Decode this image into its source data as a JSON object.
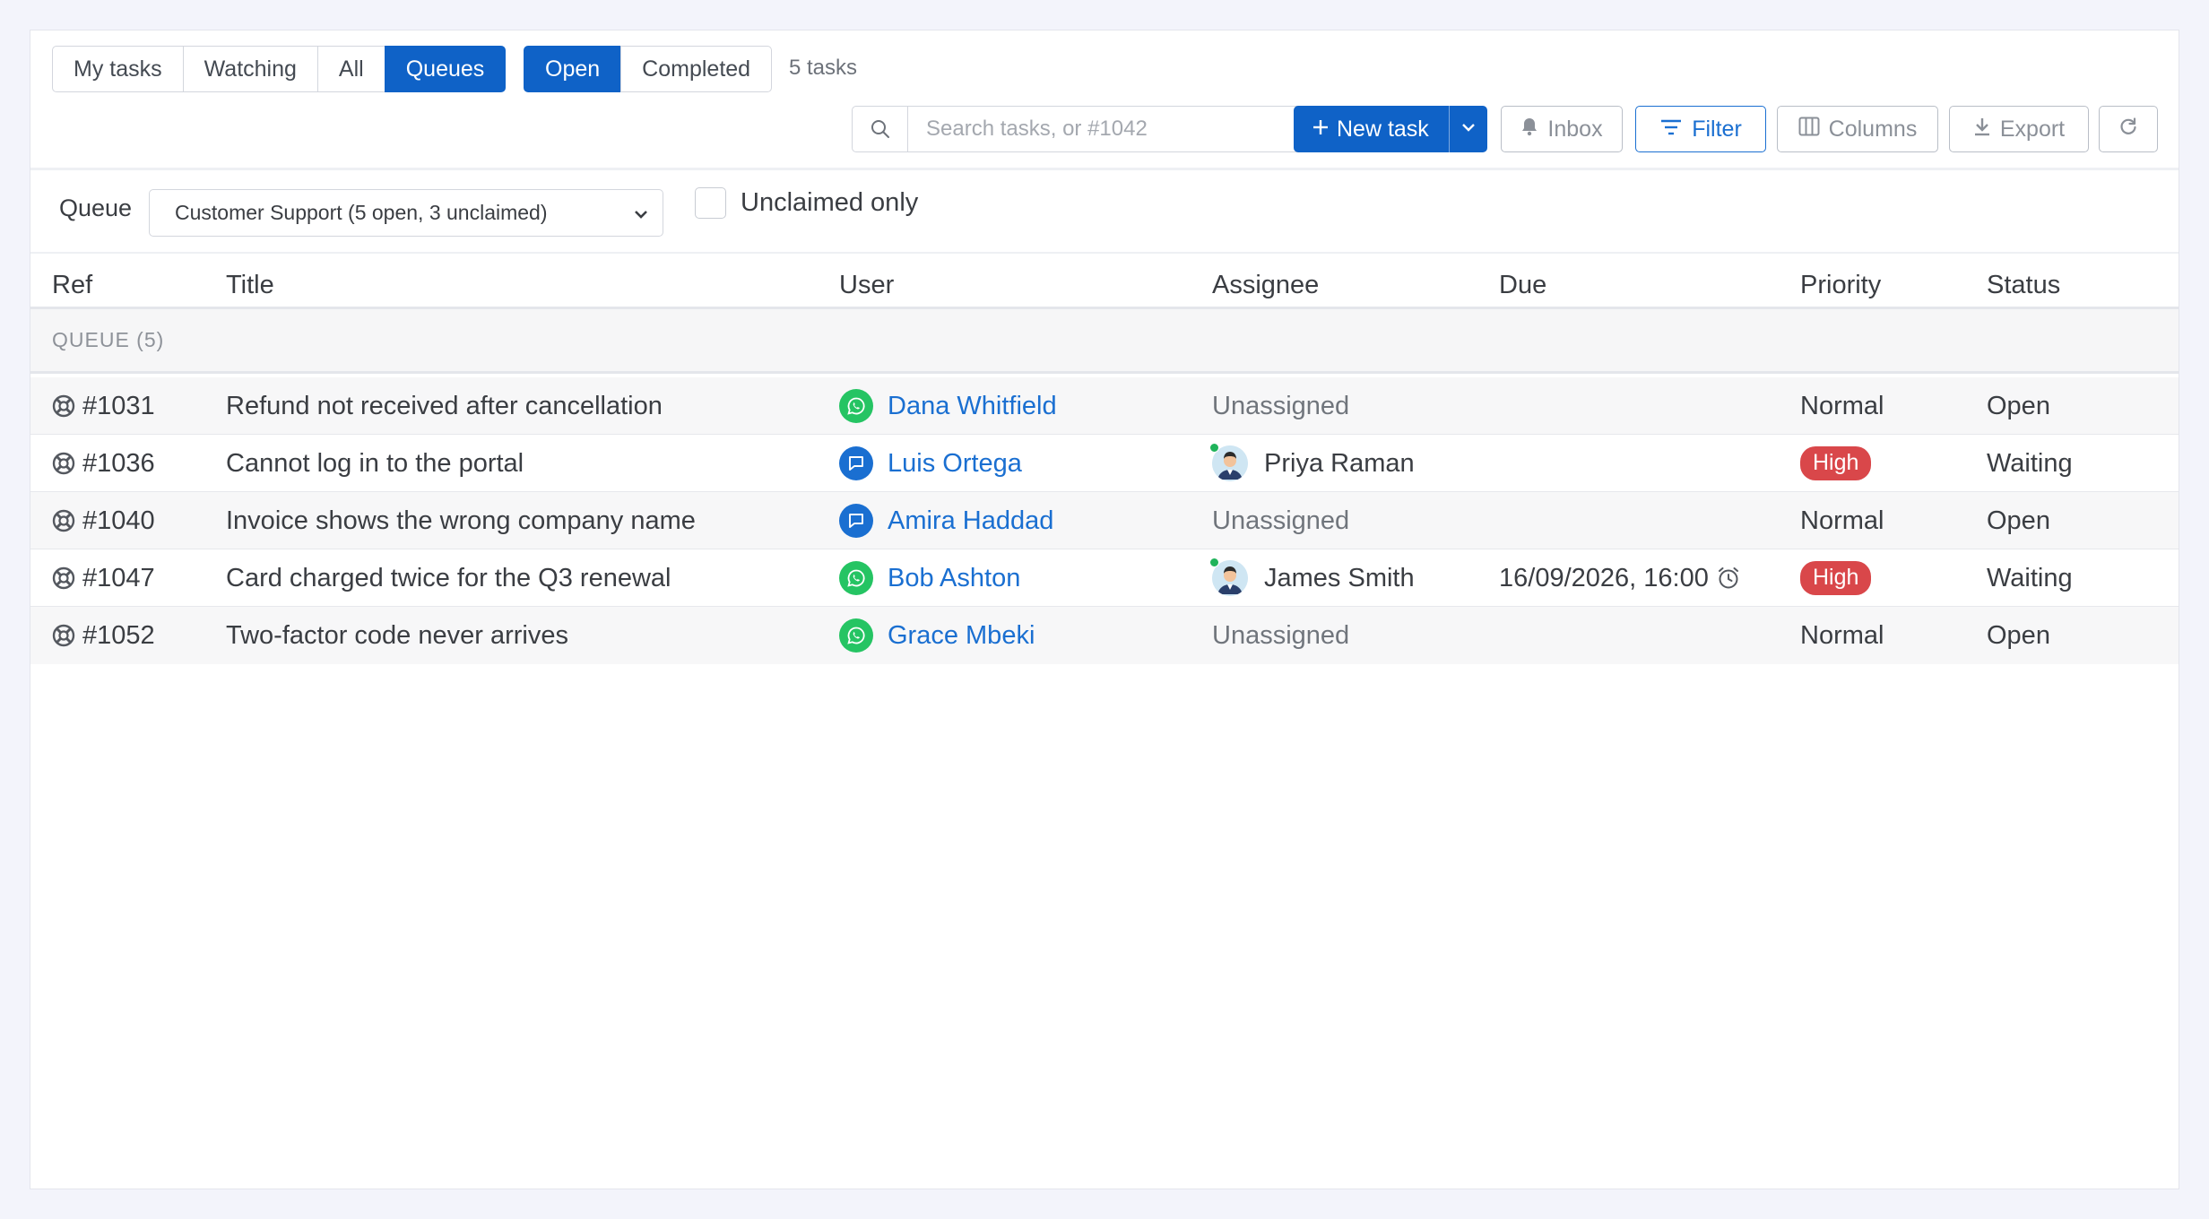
{
  "toolbar": {
    "scope_tabs": [
      {
        "label": "My tasks",
        "active": false
      },
      {
        "label": "Watching",
        "active": false
      },
      {
        "label": "All",
        "active": false
      },
      {
        "label": "Queues",
        "active": true
      }
    ],
    "state_tabs": [
      {
        "label": "Open",
        "active": true
      },
      {
        "label": "Completed",
        "active": false
      }
    ],
    "task_count": "5 tasks",
    "search_placeholder": "Search tasks, or #1042",
    "new_task_label": "New task",
    "inbox_label": "Inbox",
    "filter_label": "Filter",
    "columns_label": "Columns",
    "export_label": "Export"
  },
  "queue_filter": {
    "label": "Queue",
    "selected": "Customer Support (5 open, 3 unclaimed)",
    "unclaimed_only_label": "Unclaimed only",
    "unclaimed_only_checked": false
  },
  "table": {
    "columns": [
      "Ref",
      "Title",
      "User",
      "Assignee",
      "Due",
      "Priority",
      "Status"
    ],
    "group_label": "QUEUE (5)",
    "rows": [
      {
        "ref": "#1031",
        "title": "Refund not received after cancellation",
        "channel": "whatsapp-icon",
        "user": "Dana Whitfield",
        "assignee": "Unassigned",
        "assigned": false,
        "due": "",
        "priority": "Normal",
        "status": "Open"
      },
      {
        "ref": "#1036",
        "title": "Cannot log in to the portal",
        "channel": "chat-icon",
        "user": "Luis Ortega",
        "assignee": "Priya Raman",
        "assigned": true,
        "due": "",
        "priority": "High",
        "status": "Waiting"
      },
      {
        "ref": "#1040",
        "title": "Invoice shows the wrong company name",
        "channel": "chat-icon",
        "user": "Amira Haddad",
        "assignee": "Unassigned",
        "assigned": false,
        "due": "",
        "priority": "Normal",
        "status": "Open"
      },
      {
        "ref": "#1047",
        "title": "Card charged twice for the Q3 renewal",
        "channel": "whatsapp-icon",
        "user": "Bob Ashton",
        "assignee": "James Smith",
        "assigned": true,
        "due": "16/09/2026, 16:00",
        "priority": "High",
        "status": "Waiting"
      },
      {
        "ref": "#1052",
        "title": "Two-factor code never arrives",
        "channel": "whatsapp-icon",
        "user": "Grace Mbeki",
        "assignee": "Unassigned",
        "assigned": false,
        "due": "",
        "priority": "Normal",
        "status": "Open"
      }
    ]
  },
  "colors": {
    "accent": "#0f62c7",
    "link": "#1a6fd1",
    "high_badge": "#d9474a",
    "whatsapp": "#25c463",
    "online": "#1fb35a"
  }
}
